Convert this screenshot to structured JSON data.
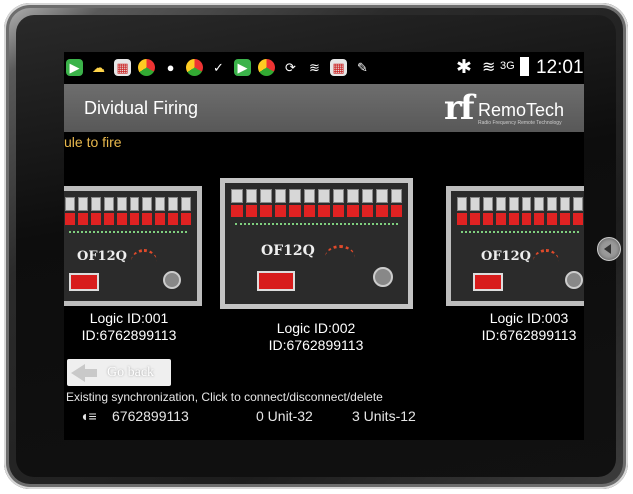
{
  "status_bar": {
    "time": "12:01",
    "network": "3G",
    "icons": [
      "play-store-icon",
      "weather-icon",
      "calendar-icon",
      "chrome-icon",
      "chat-icon",
      "chrome-icon",
      "check-icon",
      "play-store-icon",
      "chrome-icon",
      "sync-icon",
      "wifi-icon",
      "calendar-icon",
      "pen-icon"
    ]
  },
  "app": {
    "title": "Dividual Firing",
    "logo_mark": "rf",
    "logo_name": "RemoTech",
    "logo_tagline": "Radio Frequency Remote Technology",
    "subtitle": "ule to fire"
  },
  "modules": [
    {
      "model": "OF12Q",
      "logic_id": "Logic ID:001",
      "id": "ID:6762899113",
      "selected": false
    },
    {
      "model": "OF12Q",
      "logic_id": "Logic ID:002",
      "id": "ID:6762899113",
      "selected": true
    },
    {
      "model": "OF12Q",
      "logic_id": "Logic ID:003",
      "id": "ID:6762899113",
      "selected": false
    }
  ],
  "controls": {
    "go_back_label": "Go back"
  },
  "sync": {
    "label": "Existing synchronization, Click to connect/disconnect/delete",
    "rows": [
      {
        "id": "6762899113",
        "unit_a": "0 Unit-32",
        "unit_b": "3 Units-12"
      }
    ]
  },
  "colors": {
    "subtitle": "#e8b84d",
    "action_bar": "#636363",
    "fire_red": "#e02222"
  }
}
